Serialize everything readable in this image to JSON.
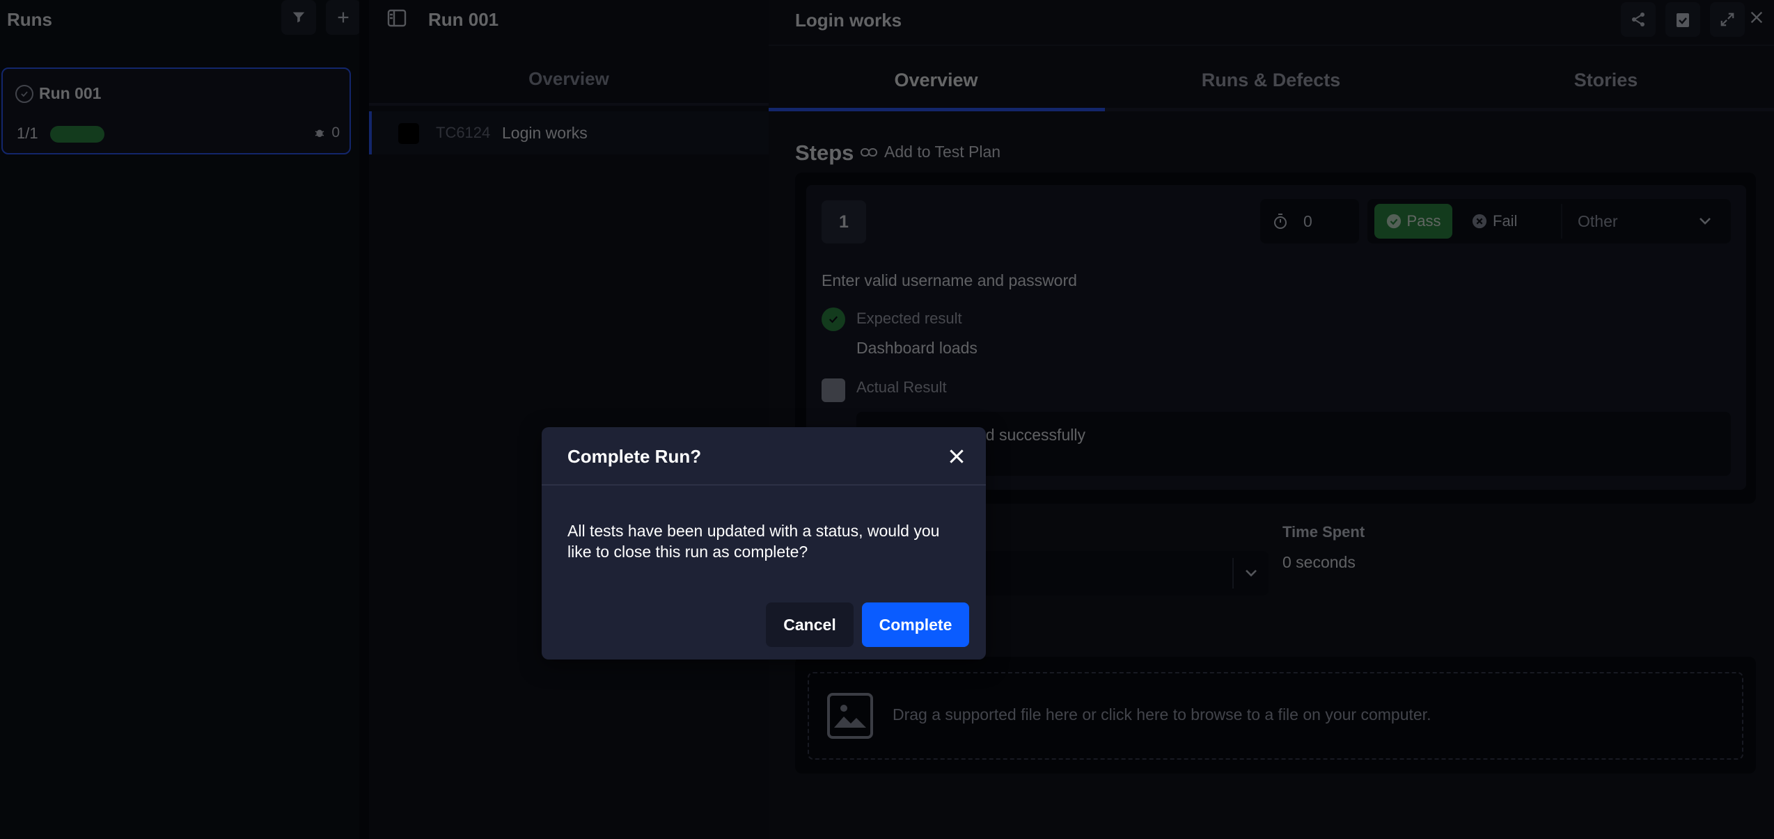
{
  "runs_panel": {
    "title": "Runs",
    "run": {
      "name": "Run 001",
      "count": "1/1",
      "progress": 1.0,
      "defects": "0"
    }
  },
  "middle": {
    "run_title": "Run 001",
    "tab": "Overview",
    "row": {
      "id": "TC6124",
      "name": "Login works"
    }
  },
  "detail": {
    "title": "Login works",
    "tabs": [
      "Overview",
      "Runs & Defects",
      "Stories"
    ],
    "steps_title": "Steps",
    "add_to_plan": "Add to Test Plan",
    "step": {
      "number": "1",
      "timer": "0",
      "pass": "Pass",
      "fail": "Fail",
      "other": "Other",
      "description": "Enter valid username and password",
      "expected_label": "Expected result",
      "expected_value": "Dashboard loads",
      "actual_label": "Actual Result",
      "actual_value": "…ed successfully"
    },
    "time_spent_label": "Time Spent",
    "time_spent_value": "0 seconds",
    "drop_text": "Drag a supported file here or click here to browse to a file on your computer."
  },
  "modal": {
    "title": "Complete Run?",
    "body": "All tests have been updated with a status, would you like to close this run as complete?",
    "cancel": "Cancel",
    "complete": "Complete"
  },
  "colors": {
    "accent": "#2d5bff",
    "primary_button": "#0a5cff",
    "pass": "#2e8c46",
    "modal_bg": "#1e2235"
  }
}
